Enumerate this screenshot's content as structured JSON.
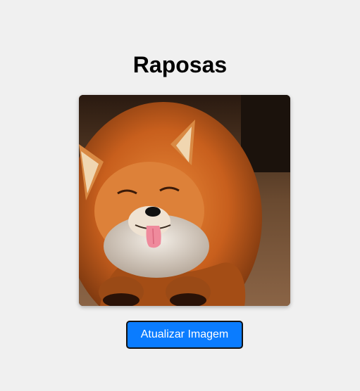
{
  "page": {
    "title": "Raposas"
  },
  "image": {
    "subject": "fox-photo"
  },
  "actions": {
    "refresh_label": "Atualizar Imagem"
  },
  "colors": {
    "background": "#f0f0f0",
    "button": "#0a7cff",
    "button_border": "#111111",
    "button_text": "#ffffff"
  }
}
